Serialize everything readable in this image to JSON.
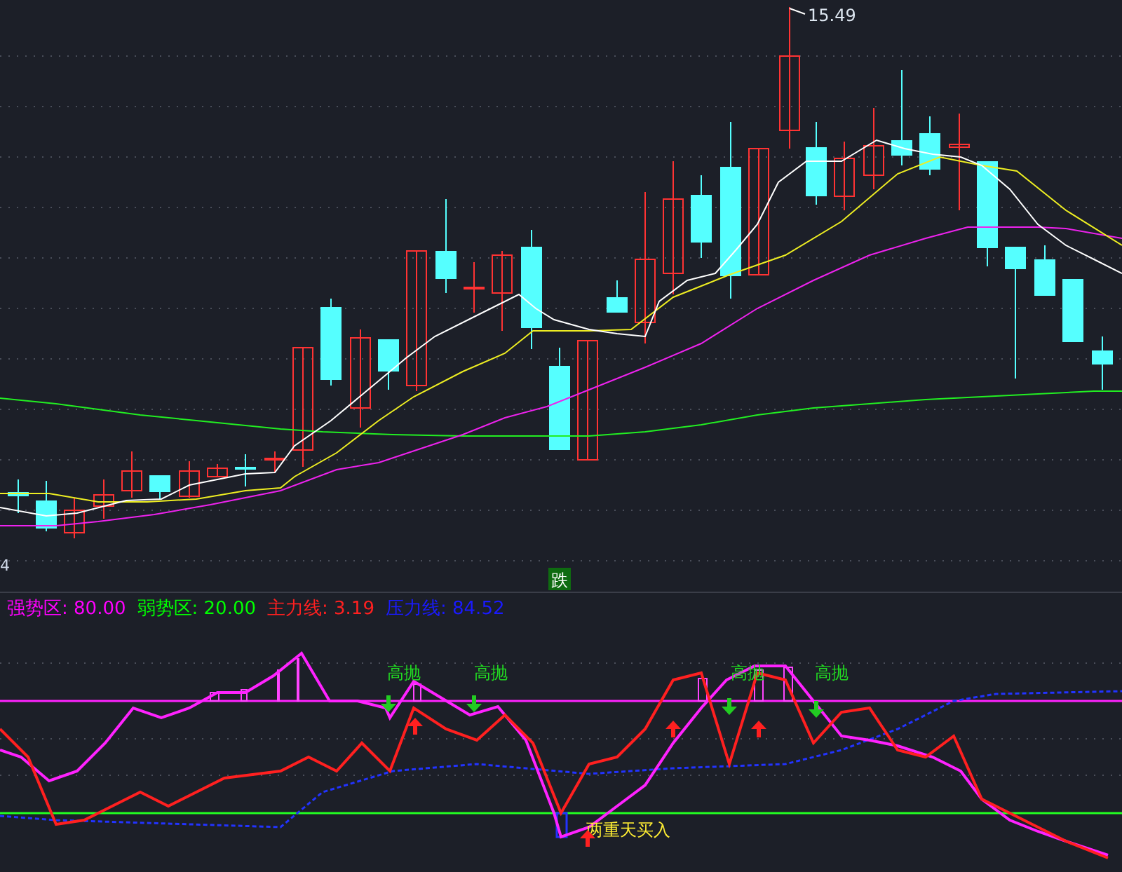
{
  "price_chart": {
    "high_label": "15.49",
    "axis_label": "4",
    "marker": {
      "label": "跌"
    }
  },
  "legend": [
    {
      "label": "强势区:",
      "value": "80.00",
      "color": "#ff00ff"
    },
    {
      "label": "弱势区:",
      "value": "20.00",
      "color": "#00ff00"
    },
    {
      "label": "主力线:",
      "value": "3.19",
      "color": "#ff2020"
    },
    {
      "label": "压力线:",
      "value": "84.52",
      "color": "#1a1aff"
    }
  ],
  "signals": [
    {
      "kind": "sell",
      "label": "高抛"
    },
    {
      "kind": "sell",
      "label": "高抛"
    },
    {
      "kind": "sell",
      "label": "高抛"
    },
    {
      "kind": "sell",
      "label": "高抛"
    },
    {
      "kind": "buy",
      "label": "两重天买入"
    }
  ]
}
